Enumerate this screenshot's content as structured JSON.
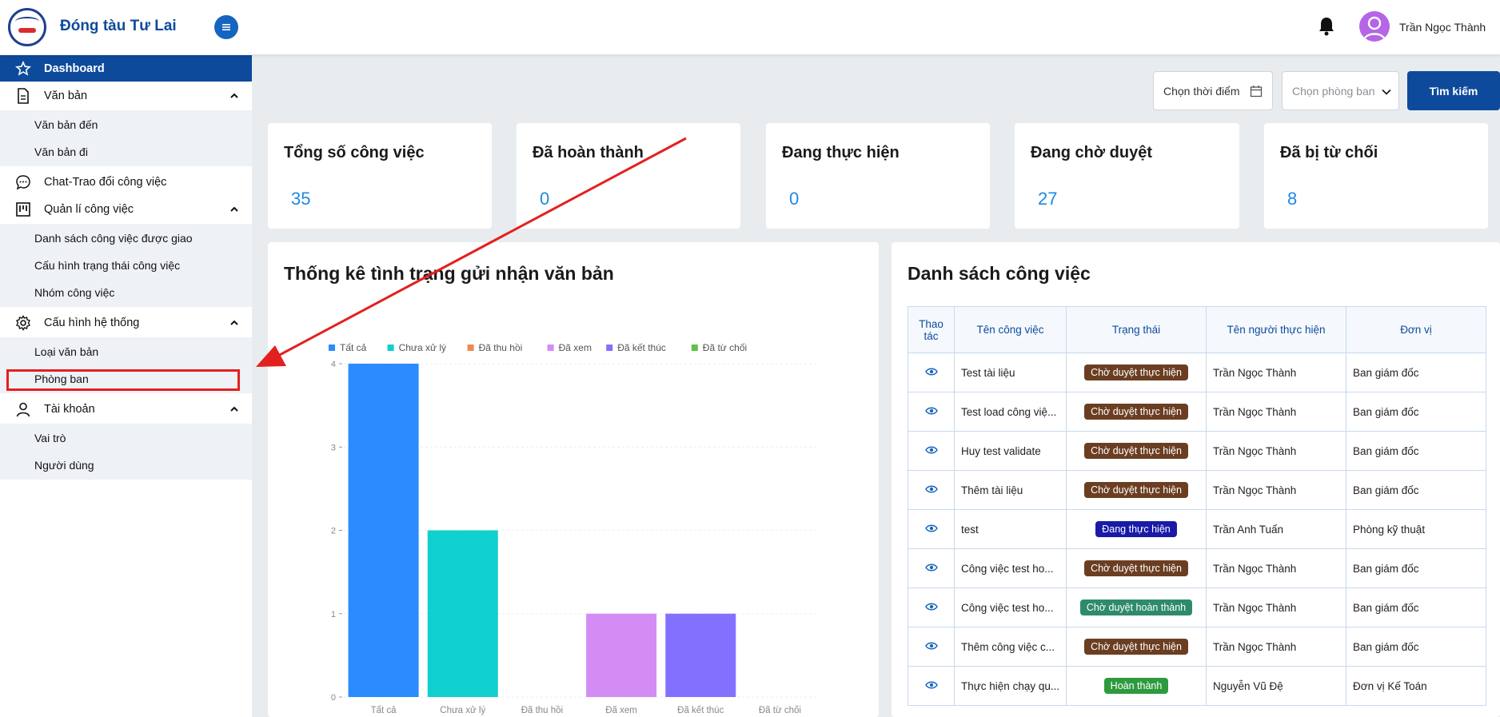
{
  "header": {
    "app_title": "Đóng tàu Tư Lai",
    "user_name": "Trần Ngọc Thành"
  },
  "sidebar": {
    "items": [
      {
        "label": "Dashboard",
        "icon": "star-icon",
        "active": true
      },
      {
        "label": "Văn bản",
        "icon": "document-icon",
        "expanded": true,
        "children": [
          "Văn bản đến",
          "Văn bản đi"
        ]
      },
      {
        "label": "Chat-Trao đổi công việc",
        "icon": "chat-icon"
      },
      {
        "label": "Quản lí công việc",
        "icon": "kanban-icon",
        "expanded": true,
        "children": [
          "Danh sách công việc được giao",
          "Cấu hình trạng thái công việc",
          "Nhóm công việc"
        ]
      },
      {
        "label": "Cấu hình hệ thống",
        "icon": "gear-icon",
        "expanded": true,
        "children": [
          "Loại văn bản",
          "Phòng ban"
        ]
      },
      {
        "label": "Tài khoản",
        "icon": "user-icon",
        "expanded": true,
        "children": [
          "Vai trò",
          "Người dùng"
        ]
      }
    ]
  },
  "filters": {
    "date_placeholder": "Chọn thời điểm",
    "dept_placeholder": "Chọn phòng ban",
    "search_label": "Tìm kiếm"
  },
  "stats": [
    {
      "title": "Tổng số công việc",
      "value": "35"
    },
    {
      "title": "Đã hoàn thành",
      "value": "0"
    },
    {
      "title": "Đang thực hiện",
      "value": "0"
    },
    {
      "title": "Đang chờ duyệt",
      "value": "27"
    },
    {
      "title": "Đã bị từ chối",
      "value": "8"
    }
  ],
  "chart_panel": {
    "title": "Thống kê tình trạng gửi nhận văn bản"
  },
  "chart_data": {
    "type": "bar",
    "categories": [
      "Tất cả",
      "Chưa xử lý",
      "Đã thu hồi",
      "Đã xem",
      "Đã kết thúc",
      "Đã từ chối"
    ],
    "values": [
      4,
      2,
      0,
      1,
      1,
      0
    ],
    "colors": [
      "#2b8bff",
      "#10cfcf",
      "#f08a4b",
      "#d48cf5",
      "#8470ff",
      "#5ec24a"
    ],
    "legend": [
      "Tất cả",
      "Chưa xử lý",
      "Đã thu hồi",
      "Đã xem",
      "Đã kết thúc",
      "Đã từ chối"
    ],
    "legend_placement": "top",
    "yticks": [
      "0",
      "1",
      "2",
      "3",
      "4"
    ],
    "ylim": [
      0,
      4
    ],
    "grid": true
  },
  "task_panel": {
    "title": "Danh sách công việc",
    "columns": [
      "Thao tác",
      "Tên công việc",
      "Trạng thái",
      "Tên người thực hiện",
      "Đơn vị"
    ],
    "column_thao_tac_line1": "Thao",
    "column_thao_tac_line2": "tác",
    "rows": [
      {
        "name": "Test tài liệu",
        "status": "Chờ duyệt thực hiện",
        "status_color": "#6b3e22",
        "person": "Trần Ngọc Thành",
        "unit": "Ban giám đốc"
      },
      {
        "name": "Test load công việ...",
        "status": "Chờ duyệt thực hiện",
        "status_color": "#6b3e22",
        "person": "Trần Ngọc Thành",
        "unit": "Ban giám đốc"
      },
      {
        "name": "Huy test validate",
        "status": "Chờ duyệt thực hiện",
        "status_color": "#6b3e22",
        "person": "Trần Ngọc Thành",
        "unit": "Ban giám đốc"
      },
      {
        "name": "Thêm tài liệu",
        "status": "Chờ duyệt thực hiện",
        "status_color": "#6b3e22",
        "person": "Trần Ngọc Thành",
        "unit": "Ban giám đốc"
      },
      {
        "name": "test",
        "status": "Đang thực hiện",
        "status_color": "#1a1aa8",
        "person": "Trần Anh Tuấn",
        "unit": "Phòng kỹ thuật"
      },
      {
        "name": "Công việc test ho...",
        "status": "Chờ duyệt thực hiện",
        "status_color": "#6b3e22",
        "person": "Trần Ngọc Thành",
        "unit": "Ban giám đốc"
      },
      {
        "name": "Công việc test ho...",
        "status": "Chờ duyệt hoàn thành",
        "status_color": "#2e8b6a",
        "person": "Trần Ngọc Thành",
        "unit": "Ban giám đốc"
      },
      {
        "name": "Thêm công việc c...",
        "status": "Chờ duyệt thực hiện",
        "status_color": "#6b3e22",
        "person": "Trần Ngọc Thành",
        "unit": "Ban giám đốc"
      },
      {
        "name": "Thực hiện chạy qu...",
        "status": "Hoàn thành",
        "status_color": "#2e9a3e",
        "person": "Nguyễn Vũ Đệ",
        "unit": "Đơn vị Kế Toán"
      }
    ]
  }
}
